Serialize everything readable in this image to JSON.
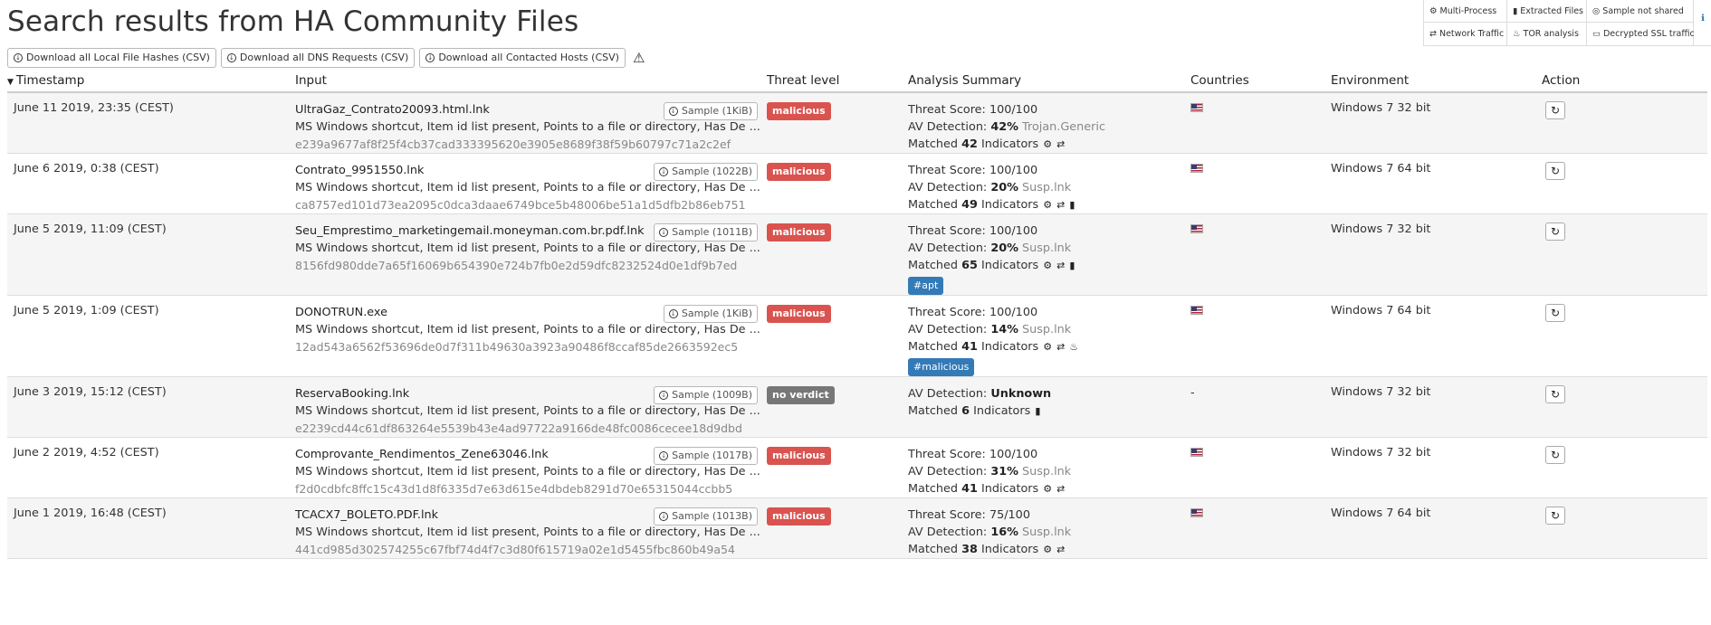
{
  "page": {
    "title": "Search results from HA Community Files",
    "downloads": [
      "Download all Local File Hashes (CSV)",
      "Download all DNS Requests (CSV)",
      "Download all Contacted Hosts (CSV)"
    ]
  },
  "legend": {
    "items": [
      {
        "icon": "gears-icon",
        "label": "Multi-Process"
      },
      {
        "icon": "file-icon",
        "label": "Extracted Files"
      },
      {
        "icon": "eye-slash-icon",
        "label": "Sample not shared"
      },
      {
        "icon": "exchange-icon",
        "label": "Network Traffic"
      },
      {
        "icon": "tor-icon",
        "label": "TOR analysis"
      },
      {
        "icon": "hdd-icon",
        "label": "Decrypted SSL traffic"
      }
    ]
  },
  "table": {
    "columns": [
      "Timestamp",
      "Input",
      "Threat level",
      "Analysis Summary",
      "Countries",
      "Environment",
      "Action"
    ],
    "rows": [
      {
        "timestamp": "June 11 2019, 23:35 (CEST)",
        "filename": "UltraGaz_Contrato20093.html.lnk",
        "description": "MS Windows shortcut, Item id list present, Points to a file or directory, Has De ...",
        "hash": "e239a9677af8f25f4cb37cad333395620e3905e8689f38f59b60797c71a2c2ef",
        "sample": "Sample (1KiB)",
        "threat": "malicious",
        "threat_score": "100/100",
        "av_pct": "42%",
        "av_name": "Trojan.Generic",
        "indicators": "42",
        "icons": [
          "gears-icon",
          "exchange-icon"
        ],
        "tag": "",
        "country": "US",
        "environment": "Windows 7 32 bit"
      },
      {
        "timestamp": "June 6 2019, 0:38 (CEST)",
        "filename": "Contrato_9951550.lnk",
        "description": "MS Windows shortcut, Item id list present, Points to a file or directory, Has De ...",
        "hash": "ca8757ed101d73ea2095c0dca3daae6749bce5b48006be51a1d5dfb2b86eb751",
        "sample": "Sample (1022B)",
        "threat": "malicious",
        "threat_score": "100/100",
        "av_pct": "20%",
        "av_name": "Susp.lnk",
        "indicators": "49",
        "icons": [
          "gears-icon",
          "exchange-icon",
          "file-icon"
        ],
        "tag": "",
        "country": "US",
        "environment": "Windows 7 64 bit"
      },
      {
        "timestamp": "June 5 2019, 11:09 (CEST)",
        "filename": "Seu_Emprestimo_marketingemail.moneyman.com.br.pdf.lnk",
        "description": "MS Windows shortcut, Item id list present, Points to a file or directory, Has De ...",
        "hash": "8156fd980dde7a65f16069b654390e724b7fb0e2d59dfc8232524d0e1df9b7ed",
        "sample": "Sample (1011B)",
        "threat": "malicious",
        "threat_score": "100/100",
        "av_pct": "20%",
        "av_name": "Susp.lnk",
        "indicators": "65",
        "icons": [
          "gears-icon",
          "exchange-icon",
          "file-icon"
        ],
        "tag": "#apt",
        "country": "US",
        "environment": "Windows 7 32 bit"
      },
      {
        "timestamp": "June 5 2019, 1:09 (CEST)",
        "filename": "DONOTRUN.exe",
        "description": "MS Windows shortcut, Item id list present, Points to a file or directory, Has De ...",
        "hash": "12ad543a6562f53696de0d7f311b49630a3923a90486f8ccaf85de2663592ec5",
        "sample": "Sample (1KiB)",
        "threat": "malicious",
        "threat_score": "100/100",
        "av_pct": "14%",
        "av_name": "Susp.lnk",
        "indicators": "41",
        "icons": [
          "gears-icon",
          "exchange-icon",
          "tor-icon"
        ],
        "tag": "#malicious",
        "country": "US",
        "environment": "Windows 7 64 bit"
      },
      {
        "timestamp": "June 3 2019, 15:12 (CEST)",
        "filename": "ReservaBooking.lnk",
        "description": "MS Windows shortcut, Item id list present, Points to a file or directory, Has De ...",
        "hash": "e2239cd44c61df863264e5539b43e4ad97722a9166de48fc0086cecee18d9dbd",
        "sample": "Sample (1009B)",
        "threat": "no verdict",
        "threat_score": "",
        "av_pct": "Unknown",
        "av_name": "",
        "indicators": "6",
        "icons": [
          "file-icon"
        ],
        "tag": "",
        "country": "-",
        "environment": "Windows 7 32 bit"
      },
      {
        "timestamp": "June 2 2019, 4:52 (CEST)",
        "filename": "Comprovante_Rendimentos_Zene63046.lnk",
        "description": "MS Windows shortcut, Item id list present, Points to a file or directory, Has De ...",
        "hash": "f2d0cdbfc8ffc15c43d1d8f6335d7e63d615e4dbdeb8291d70e65315044ccbb5",
        "sample": "Sample (1017B)",
        "threat": "malicious",
        "threat_score": "100/100",
        "av_pct": "31%",
        "av_name": "Susp.lnk",
        "indicators": "41",
        "icons": [
          "gears-icon",
          "exchange-icon"
        ],
        "tag": "",
        "country": "US",
        "environment": "Windows 7 32 bit"
      },
      {
        "timestamp": "June 1 2019, 16:48 (CEST)",
        "filename": "TCACX7_BOLETO.PDF.lnk",
        "description": "MS Windows shortcut, Item id list present, Points to a file or directory, Has De ...",
        "hash": "441cd985d302574255c67fbf74d4f7c3d80f615719a02e1d5455fbc860b49a54",
        "sample": "Sample (1013B)",
        "threat": "malicious",
        "threat_score": "75/100",
        "av_pct": "16%",
        "av_name": "Susp.lnk",
        "indicators": "38",
        "icons": [
          "gears-icon",
          "exchange-icon"
        ],
        "tag": "",
        "country": "US",
        "environment": "Windows 7 64 bit"
      }
    ]
  },
  "labels": {
    "threat_score": "Threat Score: ",
    "av_detection": "AV Detection: ",
    "matched": "Matched ",
    "indicators": " Indicators"
  }
}
